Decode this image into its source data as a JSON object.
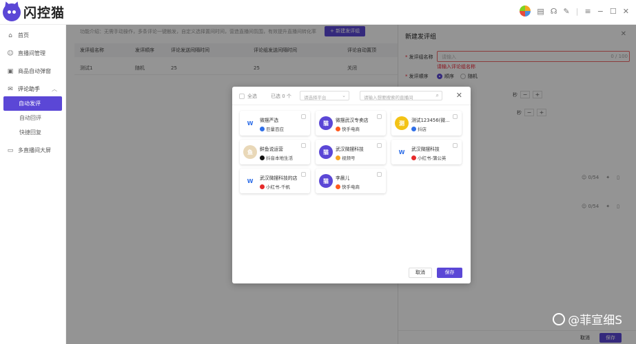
{
  "app": {
    "logo_text": "闪控猫"
  },
  "topbar": {
    "icons": [
      "avatar",
      "clipboard-icon",
      "headset-icon",
      "edit-icon",
      "menu-icon",
      "minimize-icon",
      "maximize-icon",
      "close-icon"
    ]
  },
  "sidebar": {
    "items": [
      {
        "label": "首页",
        "icon": "home-icon"
      },
      {
        "label": "直播间管理",
        "icon": "user-icon"
      },
      {
        "label": "商品自动弹窗",
        "icon": "bag-icon"
      },
      {
        "label": "评论助手",
        "icon": "chat-icon"
      }
    ],
    "subitems": [
      {
        "label": "自动发评",
        "active": true
      },
      {
        "label": "自动回评",
        "active": false
      },
      {
        "label": "快捷回复",
        "active": false
      }
    ],
    "last_item": {
      "label": "多直播间大屏",
      "icon": "screen-icon"
    }
  },
  "main": {
    "tip": "功能介绍：无需手动操作，多条评论一键触发，自定义选择置间时间，营造直播间氛围，有效提升直播间转化率",
    "new_button": "+ 新建发评组",
    "columns": [
      "发评组名称",
      "发评顺序",
      "评论发送间隔时间",
      "评论组发送间隔时间",
      "评论自动置顶"
    ],
    "rows": [
      [
        "测试1",
        "随机",
        "25",
        "25",
        "关闭"
      ]
    ]
  },
  "drawer": {
    "title": "新建发评组",
    "name_label": "发评组名称",
    "name_placeholder": "请输入",
    "name_count": "0 / 100",
    "name_error": "请输入评论组名称",
    "order_label": "发评顺序",
    "order_options": [
      "顺序",
      "随机"
    ],
    "seconds_label": "秒",
    "counter_1": "0/54",
    "counter_2": "0/54",
    "cancel": "取消",
    "save": "保存"
  },
  "modal": {
    "select_all": "全选",
    "selected_count": "已选 0 个",
    "platform_placeholder": "请选择平台",
    "search_placeholder": "请输入想要搜索的直播间",
    "cards": [
      {
        "name": "微摆严选",
        "platform": "巨量百应",
        "logo": "W",
        "logo_color": "#2f6fe8",
        "pcolor": "#2f6fe8"
      },
      {
        "name": "微摆武汉专卖店",
        "platform": "快手电商",
        "logo": "猫",
        "logo_color": "#5b47d6",
        "pcolor": "#ff5a1f"
      },
      {
        "name": "测试123456(微...",
        "platform": "抖店",
        "logo": "测",
        "logo_color": "#f3c316",
        "pcolor": "#2f6fe8"
      },
      {
        "name": "鲜鱼说运营",
        "platform": "抖音本地生活",
        "logo": "鱼",
        "logo_color": "#e9d8b8",
        "pcolor": "#111111"
      },
      {
        "name": "武汉微摆科技",
        "platform": "视频号",
        "logo": "猫",
        "logo_color": "#5b47d6",
        "pcolor": "#f5a623"
      },
      {
        "name": "武汉微摆科技",
        "platform": "小红书-蒲公英",
        "logo": "W",
        "logo_color": "#2f6fe8",
        "pcolor": "#e62b2b"
      },
      {
        "name": "武汉微摆科技的店",
        "platform": "小红书-千帆",
        "logo": "W",
        "logo_color": "#2f6fe8",
        "pcolor": "#e62b2b"
      },
      {
        "name": "李晨儿",
        "platform": "快手电商",
        "logo": "猫",
        "logo_color": "#5b47d6",
        "pcolor": "#ff5a1f"
      }
    ],
    "cancel": "取消",
    "save": "保存"
  },
  "watermark": "@菲宣细S"
}
